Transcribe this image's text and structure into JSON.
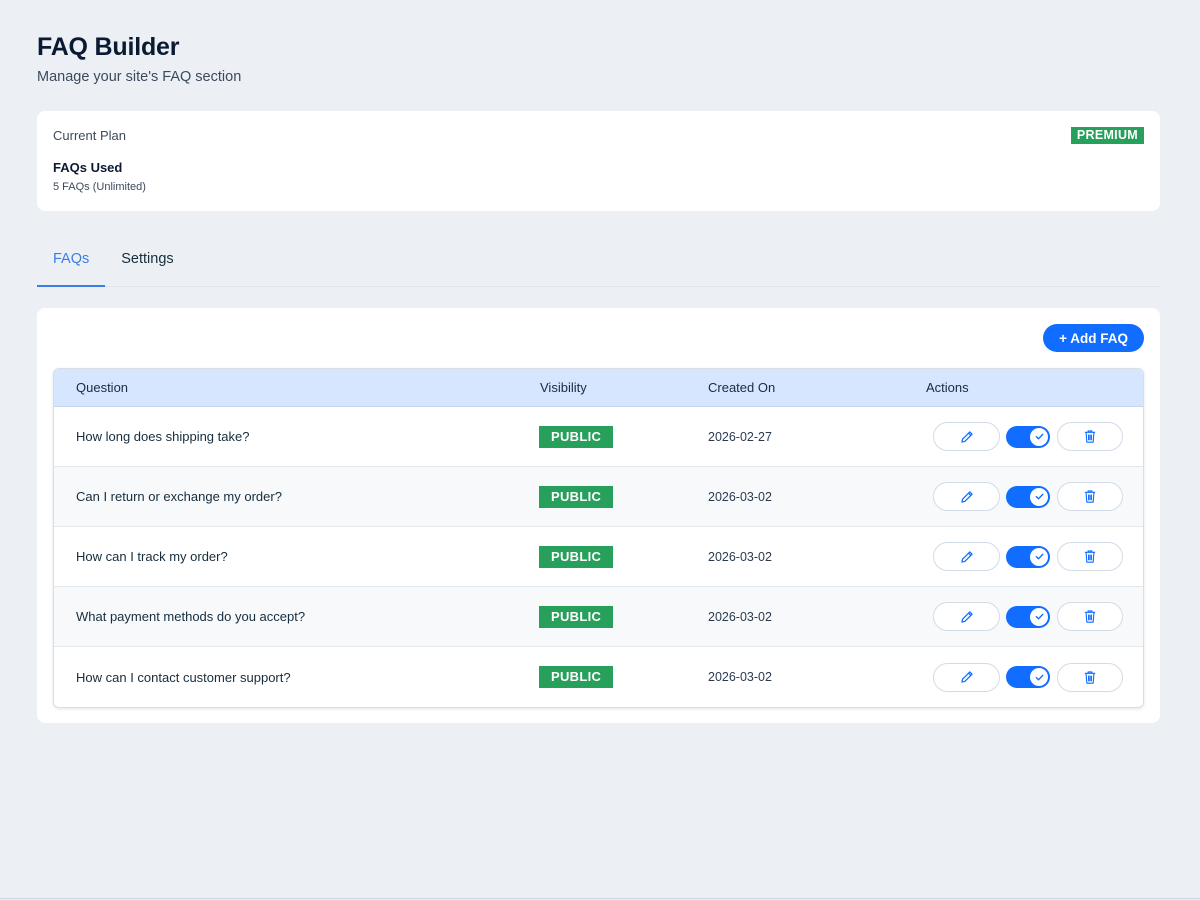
{
  "header": {
    "title": "FAQ Builder",
    "subtitle": "Manage your site's FAQ section"
  },
  "plan": {
    "label": "Current Plan",
    "badge": "PREMIUM",
    "used_title": "FAQs Used",
    "used_value": "5 FAQs (Unlimited)"
  },
  "tabs": [
    {
      "label": "FAQs",
      "active": true
    },
    {
      "label": "Settings",
      "active": false
    }
  ],
  "toolbar": {
    "add_label": "+ Add FAQ"
  },
  "table": {
    "headers": {
      "question": "Question",
      "visibility": "Visibility",
      "created": "Created On",
      "actions": "Actions"
    },
    "rows": [
      {
        "question": "How long does shipping take?",
        "visibility": "PUBLIC",
        "created": "2026-02-27",
        "enabled": true
      },
      {
        "question": "Can I return or exchange my order?",
        "visibility": "PUBLIC",
        "created": "2026-03-02",
        "enabled": true
      },
      {
        "question": "How can I track my order?",
        "visibility": "PUBLIC",
        "created": "2026-03-02",
        "enabled": true
      },
      {
        "question": "What payment methods do you accept?",
        "visibility": "PUBLIC",
        "created": "2026-03-02",
        "enabled": true
      },
      {
        "question": "How can I contact customer support?",
        "visibility": "PUBLIC",
        "created": "2026-03-02",
        "enabled": true
      }
    ]
  },
  "icons": {
    "edit": "pencil-icon",
    "toggle": "check-icon",
    "delete": "trash-icon"
  },
  "colors": {
    "accent": "#116dff",
    "success": "#26a05a",
    "header_bg": "#d6e6fe",
    "page_bg": "#ecf0f5"
  }
}
